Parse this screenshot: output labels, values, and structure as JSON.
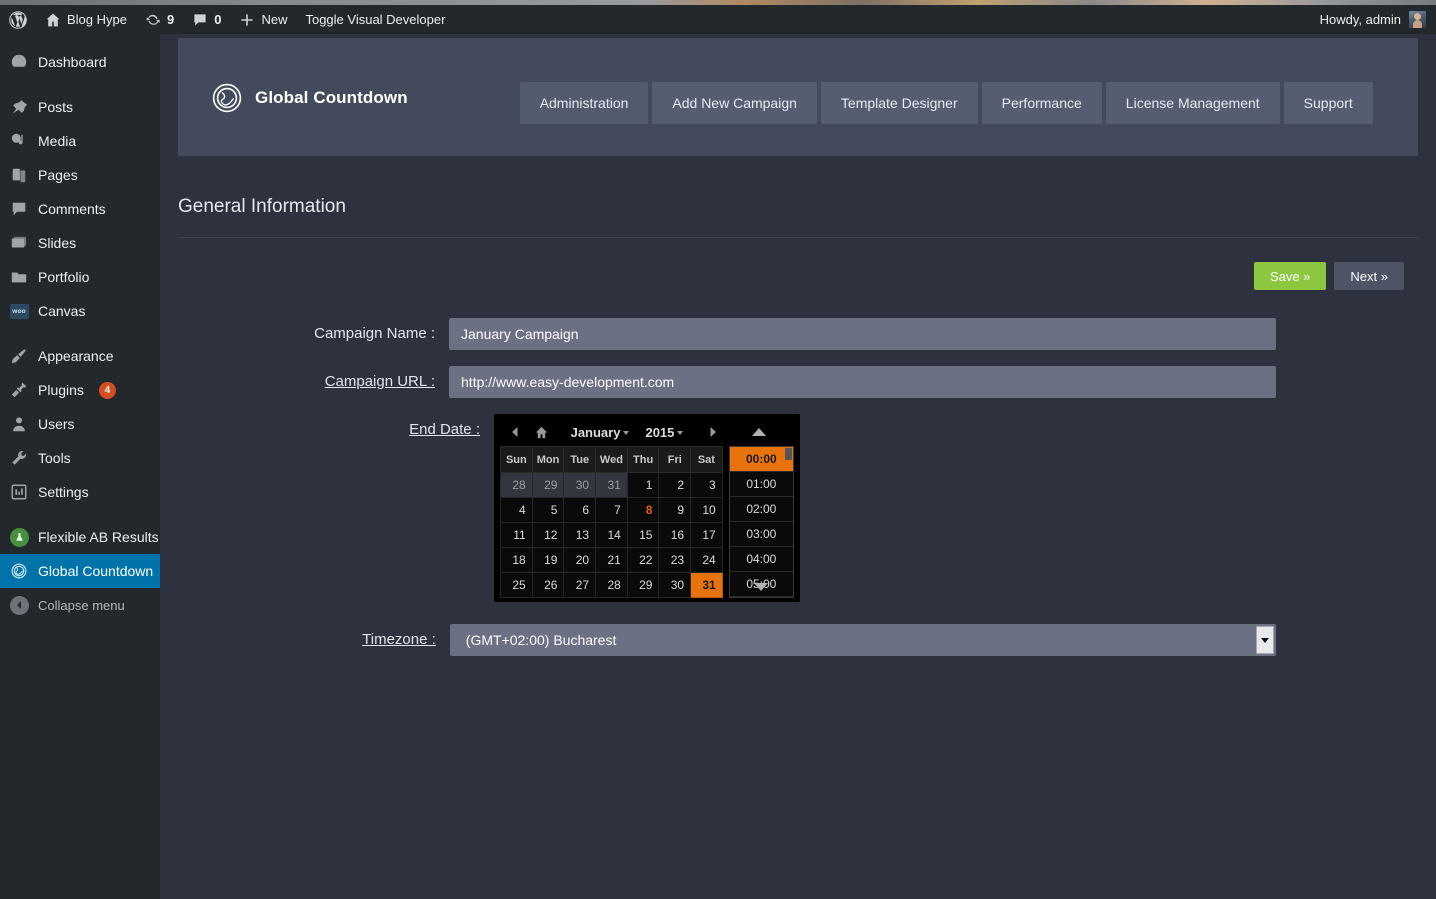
{
  "adminbar": {
    "site_name": "Blog Hype",
    "updates_count": "9",
    "comments_count": "0",
    "new_label": "New",
    "toggle_label": "Toggle Visual Developer",
    "howdy": "Howdy, admin"
  },
  "sidebar": {
    "items": [
      {
        "label": "Dashboard",
        "icon": "dashboard-icon",
        "current": false
      },
      {
        "label": "Posts",
        "icon": "pin-icon",
        "current": false
      },
      {
        "label": "Media",
        "icon": "media-icon",
        "current": false
      },
      {
        "label": "Pages",
        "icon": "pages-icon",
        "current": false
      },
      {
        "label": "Comments",
        "icon": "comment-icon",
        "current": false
      },
      {
        "label": "Slides",
        "icon": "slides-icon",
        "current": false
      },
      {
        "label": "Portfolio",
        "icon": "folder-icon",
        "current": false
      },
      {
        "label": "Canvas",
        "icon": "woo-icon",
        "current": false
      },
      {
        "label": "Appearance",
        "icon": "brush-icon",
        "current": false
      },
      {
        "label": "Plugins",
        "icon": "plug-icon",
        "current": false,
        "badge": "4"
      },
      {
        "label": "Users",
        "icon": "user-icon",
        "current": false
      },
      {
        "label": "Tools",
        "icon": "wrench-icon",
        "current": false
      },
      {
        "label": "Settings",
        "icon": "settings-icon",
        "current": false
      },
      {
        "label": "Flexible AB Results",
        "icon": "flask-icon",
        "current": false
      },
      {
        "label": "Global Countdown",
        "icon": "globe-icon",
        "current": true
      }
    ],
    "collapse_label": "Collapse menu"
  },
  "panel": {
    "brand": "Global Countdown",
    "tabs": [
      {
        "label": "Administration",
        "active": true
      },
      {
        "label": "Add New Campaign",
        "active": false
      },
      {
        "label": "Template Designer",
        "active": false
      },
      {
        "label": "Performance",
        "active": false
      },
      {
        "label": "License Management",
        "active": false
      },
      {
        "label": "Support",
        "active": false
      }
    ]
  },
  "section": {
    "title": "General Information"
  },
  "actions": {
    "save_label": "Save »",
    "next_label": "Next »",
    "save_color": "#8dc63f"
  },
  "form": {
    "campaign_name": {
      "label": "Campaign Name :",
      "value": "January Campaign",
      "placeholder": "Campaign Name"
    },
    "campaign_url": {
      "label": "Campaign URL :",
      "value": "http://www.easy-development.com",
      "placeholder": "Campaign URL"
    },
    "end_date": {
      "label": "End Date :"
    },
    "timezone": {
      "label": "Timezone :",
      "value": "(GMT+02:00) Bucharest"
    }
  },
  "datepicker": {
    "month": "January",
    "year": "2015",
    "prev_icon": "triangle-left-icon",
    "home_icon": "home-icon",
    "next_icon": "triangle-right-icon",
    "up_icon": "triangle-up-icon",
    "down_icon": "triangle-down-icon",
    "weekdays": [
      "Sun",
      "Mon",
      "Tue",
      "Wed",
      "Thu",
      "Fri",
      "Sat"
    ],
    "weeks": [
      [
        {
          "d": "28",
          "other": true
        },
        {
          "d": "29",
          "other": true
        },
        {
          "d": "30",
          "other": true
        },
        {
          "d": "31",
          "other": true
        },
        {
          "d": "1"
        },
        {
          "d": "2"
        },
        {
          "d": "3"
        }
      ],
      [
        {
          "d": "4"
        },
        {
          "d": "5"
        },
        {
          "d": "6"
        },
        {
          "d": "7"
        },
        {
          "d": "8",
          "today": true
        },
        {
          "d": "9"
        },
        {
          "d": "10"
        }
      ],
      [
        {
          "d": "11"
        },
        {
          "d": "12"
        },
        {
          "d": "13"
        },
        {
          "d": "14"
        },
        {
          "d": "15"
        },
        {
          "d": "16"
        },
        {
          "d": "17"
        }
      ],
      [
        {
          "d": "18"
        },
        {
          "d": "19"
        },
        {
          "d": "20"
        },
        {
          "d": "21"
        },
        {
          "d": "22"
        },
        {
          "d": "23"
        },
        {
          "d": "24"
        }
      ],
      [
        {
          "d": "25"
        },
        {
          "d": "26"
        },
        {
          "d": "27"
        },
        {
          "d": "28"
        },
        {
          "d": "29"
        },
        {
          "d": "30"
        },
        {
          "d": "31",
          "sel": true
        }
      ]
    ],
    "times": [
      {
        "t": "00:00",
        "sel": true
      },
      {
        "t": "01:00"
      },
      {
        "t": "02:00"
      },
      {
        "t": "03:00"
      },
      {
        "t": "04:00"
      },
      {
        "t": "05:00"
      }
    ],
    "selected_color": "#e8730c",
    "today_color": "#e8590c"
  }
}
